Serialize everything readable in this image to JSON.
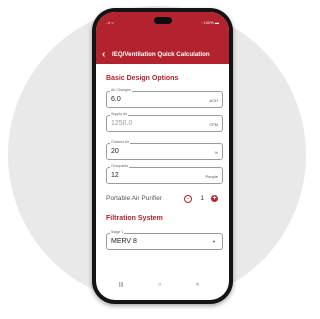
{
  "status": {
    "left": "..ıl ≈",
    "right": "◦ 100% ▬"
  },
  "app_bar": {
    "back": "‹",
    "title": "IEQ/Ventilation Quick Calculation"
  },
  "basic": {
    "title": "Basic Design Options",
    "air_changes": {
      "label": "Air Changes",
      "value": "6.0",
      "unit": "ACH"
    },
    "supply_air": {
      "label": "Supply Air",
      "value": "1250.0",
      "unit": "CFM"
    },
    "outdoor_air": {
      "label": "Outdoor Air",
      "value": "20",
      "unit": "%"
    },
    "occupants": {
      "label": "Occupants",
      "value": "12",
      "unit": "People"
    },
    "purifier": {
      "label": "Portable Air Purifier",
      "minus": "−",
      "count": "1",
      "plus": "+"
    }
  },
  "filtration": {
    "title": "Filtration System",
    "stage": {
      "label": "Stage 1",
      "value": "MERV 8",
      "caret": "▼"
    }
  },
  "nav": {
    "recent": "|||",
    "home": "○",
    "back": "<"
  },
  "colors": {
    "accent": "#b3232f",
    "background_circle": "#e9e9ea",
    "phone_frame": "#141416"
  }
}
